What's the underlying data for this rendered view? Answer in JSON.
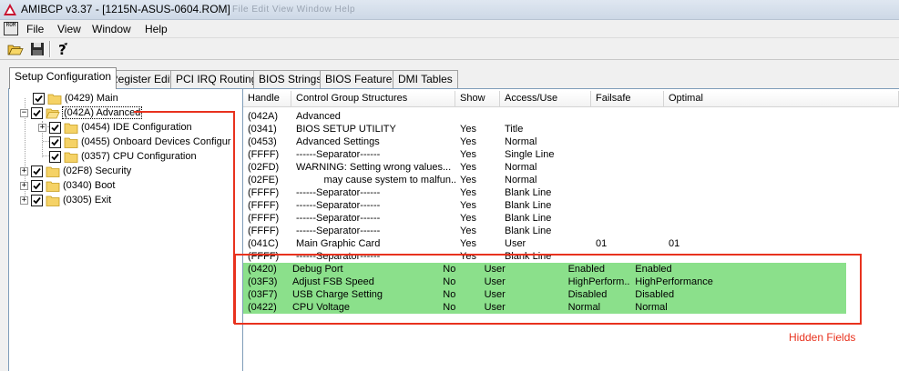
{
  "window": {
    "title": "AMIBCP v3.37 - [1215N-ASUS-0604.ROM]",
    "ghost_menu_text": "File   Edit   View   Window   Help"
  },
  "menubar": {
    "items": [
      "File",
      "View",
      "Window",
      "Help"
    ],
    "system_icon_text": "ROM"
  },
  "toolbar": {
    "buttons": [
      "open-folder",
      "save",
      "help"
    ]
  },
  "tabs": [
    "Setup Configuration",
    "Register Edit",
    "PCI IRQ Routing",
    "BIOS Strings",
    "BIOS Features",
    "DMI Tables"
  ],
  "tree": {
    "items": [
      {
        "label": "(0429) Main"
      },
      {
        "label": "(042A) Advanced"
      },
      {
        "label": "(0454) IDE Configuration"
      },
      {
        "label": "(0455) Onboard Devices Configur"
      },
      {
        "label": "(0357) CPU Configuration"
      },
      {
        "label": "(02F8) Security"
      },
      {
        "label": "(0340) Boot"
      },
      {
        "label": "(0305) Exit"
      }
    ]
  },
  "grid": {
    "columns": [
      "Handle",
      "Control Group Structures",
      "Show",
      "Access/Use",
      "Failsafe",
      "Optimal"
    ],
    "rows": [
      [
        "(042A)",
        "Advanced",
        "",
        "",
        "",
        ""
      ],
      [
        "(0341)",
        "BIOS SETUP UTILITY",
        "Yes",
        "Title",
        "",
        ""
      ],
      [
        "(0453)",
        "Advanced Settings",
        "Yes",
        "Normal",
        "",
        ""
      ],
      [
        "(FFFF)",
        "------Separator------",
        "Yes",
        "Single Line",
        "",
        ""
      ],
      [
        "(02FD)",
        "WARNING: Setting wrong values...",
        "Yes",
        "Normal",
        "",
        ""
      ],
      [
        "(02FE)",
        "          may cause system to malfun...",
        "Yes",
        "Normal",
        "",
        ""
      ],
      [
        "(FFFF)",
        "------Separator------",
        "Yes",
        "Blank Line",
        "",
        ""
      ],
      [
        "(FFFF)",
        "------Separator------",
        "Yes",
        "Blank Line",
        "",
        ""
      ],
      [
        "(FFFF)",
        "------Separator------",
        "Yes",
        "Blank Line",
        "",
        ""
      ],
      [
        "(FFFF)",
        "------Separator------",
        "Yes",
        "Blank Line",
        "",
        ""
      ],
      [
        "(041C)",
        "Main Graphic Card",
        "Yes",
        "User",
        "01",
        "01"
      ],
      [
        "(FFFF)",
        "------Separator------",
        "Yes",
        "Blank Line",
        "",
        ""
      ],
      [
        "(0420)",
        "Debug Port",
        "No",
        "User",
        "Enabled",
        "Enabled"
      ],
      [
        "(03F3)",
        "Adjust FSB Speed",
        "No",
        "User",
        "HighPerform...",
        "HighPerformance"
      ],
      [
        "(03F7)",
        "USB Charge Setting",
        "No",
        "User",
        "Disabled",
        "Disabled"
      ],
      [
        "(0422)",
        "CPU Voltage",
        "No",
        "User",
        "Normal",
        "Normal"
      ]
    ]
  },
  "annotation": {
    "label": "Hidden Fields",
    "color": "#e8321e"
  },
  "colors": {
    "hidden_row": "#8be08b",
    "annotation": "#e8321e"
  }
}
